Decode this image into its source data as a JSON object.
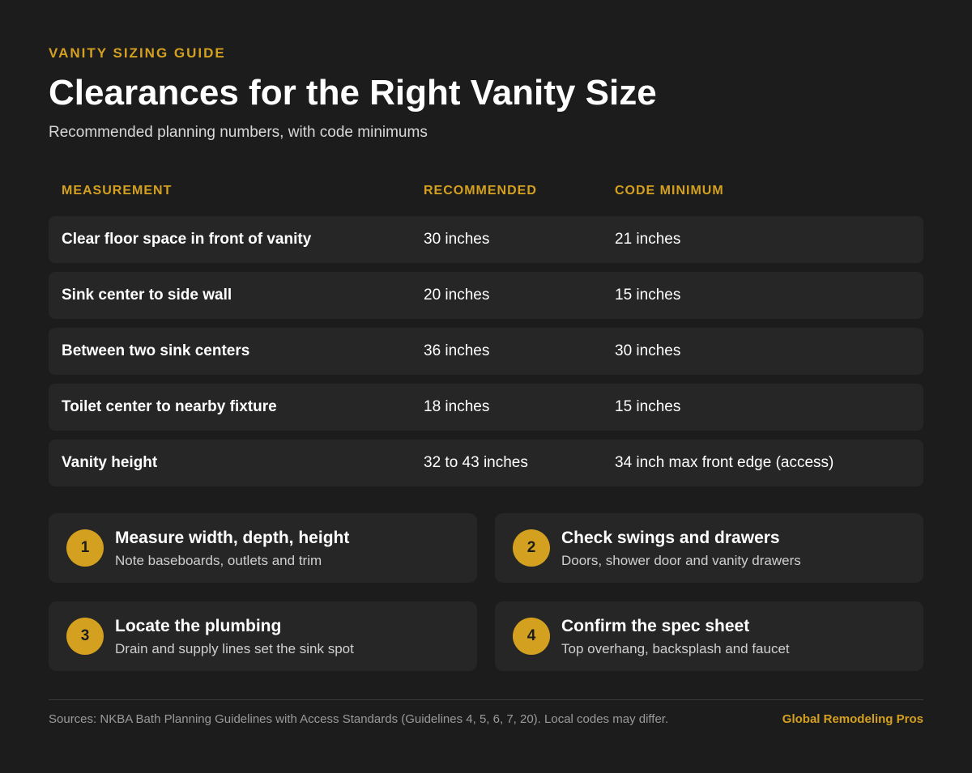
{
  "header": {
    "eyebrow": "VANITY SIZING GUIDE",
    "title": "Clearances for the Right Vanity Size",
    "subtitle": "Recommended planning numbers, with code minimums"
  },
  "table": {
    "columns": [
      "MEASUREMENT",
      "RECOMMENDED",
      "CODE MINIMUM"
    ],
    "rows": [
      {
        "measurement": "Clear floor space in front of vanity",
        "recommended": "30 inches",
        "minimum": "21 inches"
      },
      {
        "measurement": "Sink center to side wall",
        "recommended": "20 inches",
        "minimum": "15 inches"
      },
      {
        "measurement": "Between two sink centers",
        "recommended": "36 inches",
        "minimum": "30 inches"
      },
      {
        "measurement": "Toilet center to nearby fixture",
        "recommended": "18 inches",
        "minimum": "15 inches"
      },
      {
        "measurement": "Vanity height",
        "recommended": "32 to 43 inches",
        "minimum": "34 inch max front edge (access)"
      }
    ]
  },
  "steps": [
    {
      "number": "1",
      "title": "Measure width, depth, height",
      "desc": "Note baseboards, outlets and trim"
    },
    {
      "number": "2",
      "title": "Check swings and drawers",
      "desc": "Doors, shower door and vanity drawers"
    },
    {
      "number": "3",
      "title": "Locate the plumbing",
      "desc": "Drain and supply lines set the sink spot"
    },
    {
      "number": "4",
      "title": "Confirm the spec sheet",
      "desc": "Top overhang, backsplash and faucet"
    }
  ],
  "footer": {
    "sources": "Sources: NKBA Bath Planning Guidelines with Access Standards (Guidelines 4, 5, 6, 7, 20). Local codes may differ.",
    "brand": "Global Remodeling Pros"
  },
  "colors": {
    "background": "#1c1c1c",
    "card": "#262626",
    "accent": "#d4a020",
    "text": "#ffffff"
  }
}
